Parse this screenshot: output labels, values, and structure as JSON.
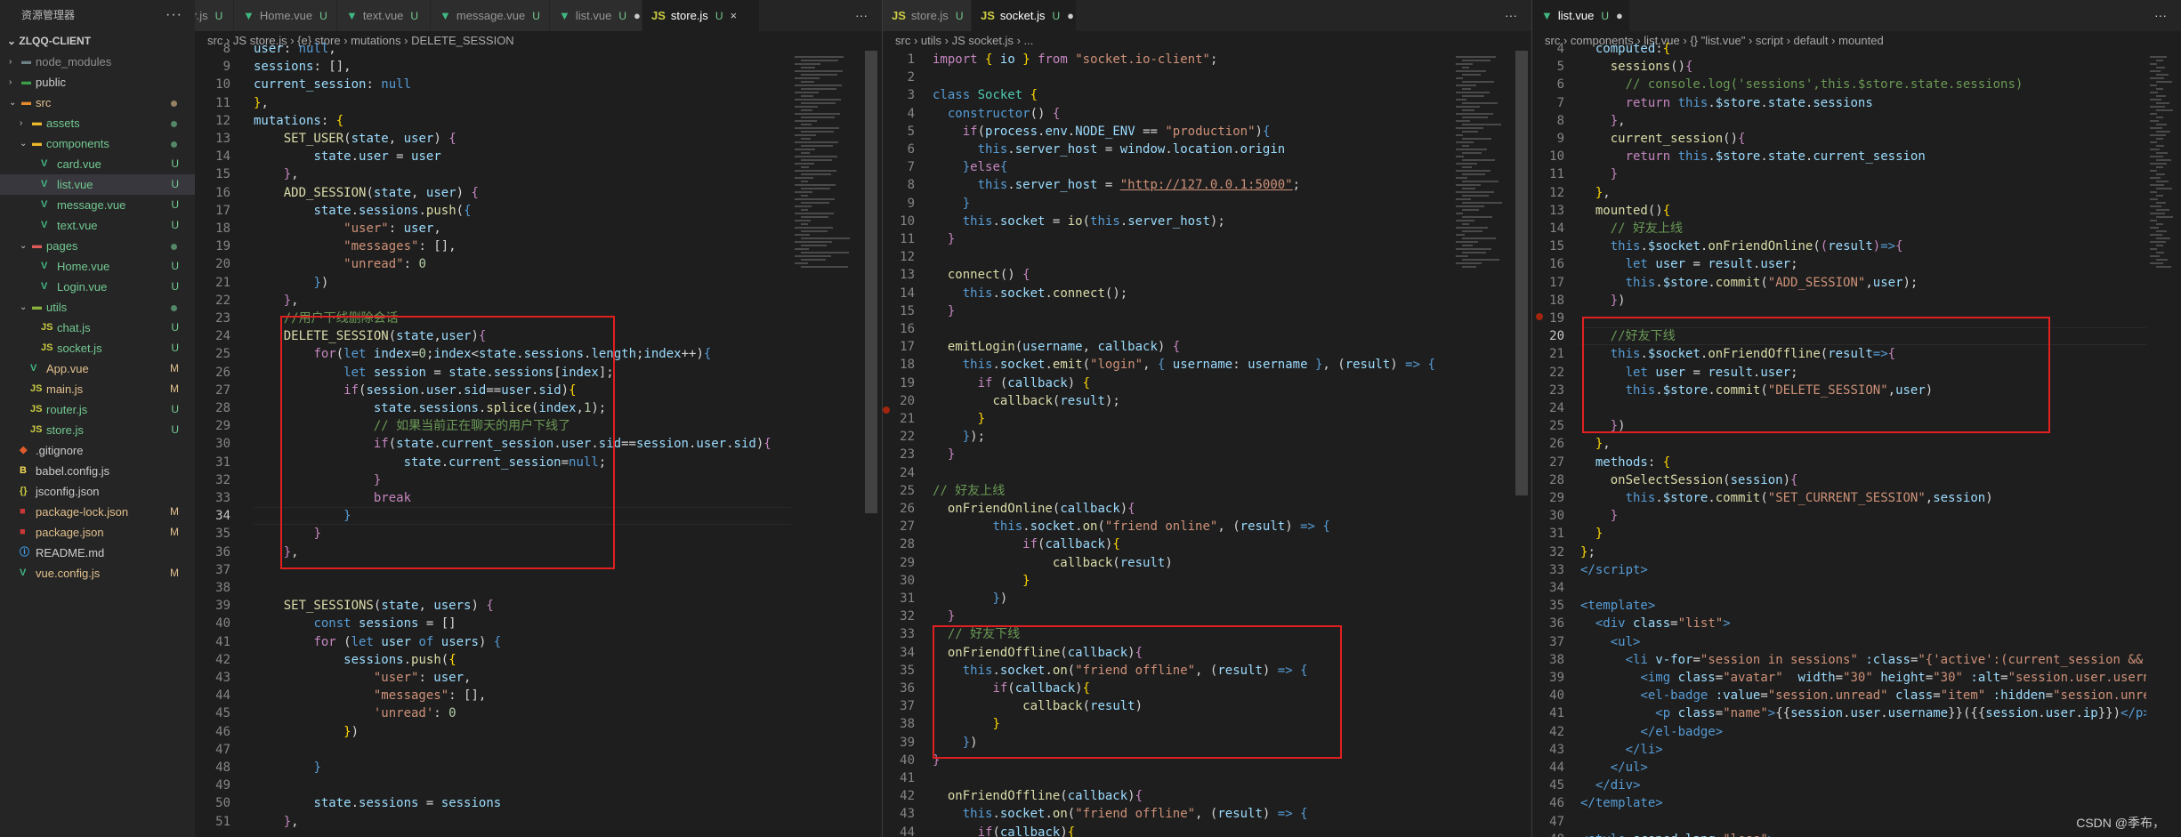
{
  "explorer": {
    "title": "资源管理器",
    "more": "···",
    "project": "ZLQQ-CLIENT"
  },
  "tree": [
    {
      "name": "node_modules",
      "kind": "folder",
      "depth": 1,
      "open": false,
      "icon": "#6d8086",
      "color": "#8f8f8f"
    },
    {
      "name": "public",
      "kind": "folder",
      "depth": 1,
      "open": false,
      "icon": "#3c9e48",
      "color": "#cccccc"
    },
    {
      "name": "src",
      "kind": "folder",
      "depth": 1,
      "open": true,
      "icon": "#e8892b",
      "color": "#e2c08d",
      "dot": true
    },
    {
      "name": "assets",
      "kind": "folder",
      "depth": 2,
      "open": false,
      "icon": "#e8b92b",
      "color": "#73c991",
      "dot": true
    },
    {
      "name": "components",
      "kind": "folder",
      "depth": 2,
      "open": true,
      "icon": "#e8b92b",
      "color": "#73c991",
      "dot": true
    },
    {
      "name": "card.vue",
      "kind": "vue",
      "depth": 3,
      "color": "#73c991",
      "badge": "U"
    },
    {
      "name": "list.vue",
      "kind": "vue",
      "depth": 3,
      "color": "#73c991",
      "badge": "U",
      "selected": true
    },
    {
      "name": "message.vue",
      "kind": "vue",
      "depth": 3,
      "color": "#73c991",
      "badge": "U"
    },
    {
      "name": "text.vue",
      "kind": "vue",
      "depth": 3,
      "color": "#73c991",
      "badge": "U"
    },
    {
      "name": "pages",
      "kind": "folder",
      "depth": 2,
      "open": true,
      "icon": "#e05a5a",
      "color": "#73c991",
      "dot": true
    },
    {
      "name": "Home.vue",
      "kind": "vue",
      "depth": 3,
      "color": "#73c991",
      "badge": "U"
    },
    {
      "name": "Login.vue",
      "kind": "vue",
      "depth": 3,
      "color": "#73c991",
      "badge": "U"
    },
    {
      "name": "utils",
      "kind": "folder",
      "depth": 2,
      "open": true,
      "icon": "#8ab23a",
      "color": "#73c991",
      "dot": true
    },
    {
      "name": "chat.js",
      "kind": "js",
      "depth": 3,
      "color": "#73c991",
      "badge": "U"
    },
    {
      "name": "socket.js",
      "kind": "js",
      "depth": 3,
      "color": "#73c991",
      "badge": "U"
    },
    {
      "name": "App.vue",
      "kind": "vue",
      "depth": 2,
      "color": "#e2c08d",
      "badge": "M"
    },
    {
      "name": "main.js",
      "kind": "js",
      "depth": 2,
      "color": "#e2c08d",
      "badge": "M"
    },
    {
      "name": "router.js",
      "kind": "js",
      "depth": 2,
      "color": "#73c991",
      "badge": "U"
    },
    {
      "name": "store.js",
      "kind": "js",
      "depth": 2,
      "color": "#73c991",
      "badge": "U"
    },
    {
      "name": ".gitignore",
      "kind": "git",
      "depth": 1,
      "color": "#cccccc"
    },
    {
      "name": "babel.config.js",
      "kind": "babel",
      "depth": 1,
      "color": "#cccccc"
    },
    {
      "name": "jsconfig.json",
      "kind": "json",
      "depth": 1,
      "color": "#cccccc"
    },
    {
      "name": "package-lock.json",
      "kind": "npm",
      "depth": 1,
      "color": "#e2c08d",
      "badge": "M"
    },
    {
      "name": "package.json",
      "kind": "npm",
      "depth": 1,
      "color": "#e2c08d",
      "badge": "M"
    },
    {
      "name": "README.md",
      "kind": "info",
      "depth": 1,
      "color": "#cccccc"
    },
    {
      "name": "vue.config.js",
      "kind": "vuecfg",
      "depth": 1,
      "color": "#e2c08d",
      "badge": "M"
    }
  ],
  "panes": [
    {
      "id": "left",
      "tabs": [
        {
          "label": "r.js",
          "icon": "",
          "mark": "U"
        },
        {
          "label": "Home.vue",
          "icon": "vue",
          "mark": "U"
        },
        {
          "label": "text.vue",
          "icon": "vue",
          "mark": "U"
        },
        {
          "label": "message.vue",
          "icon": "vue",
          "mark": "U"
        },
        {
          "label": "list.vue",
          "icon": "vue",
          "mark": "U",
          "dirty": true
        },
        {
          "label": "store.js",
          "icon": "JS",
          "mark": "U",
          "active": true,
          "close": "×"
        }
      ],
      "crumbs": [
        "src",
        "JS store.js",
        "{e} store",
        "mutations",
        "DELETE_SESSION"
      ],
      "start": 8,
      "lines": [
        "<span class='v'>user</span>: <span class='kb'>null</span>,",
        "<span class='v'>sessions</span>: [],",
        "<span class='v'>current_session</span>: <span class='kb'>null</span>",
        "<span class='p'>}</span>,",
        "<span class='v'>mutations</span>: <span class='p'>{</span>",
        "    <span class='f'>SET_USER</span>(<span class='v'>state</span>, <span class='v'>user</span>) <span class='k'>{</span>",
        "        <span class='v'>state</span>.<span class='v'>user</span> = <span class='v'>user</span>",
        "    <span class='k'>}</span>,",
        "    <span class='f'>ADD_SESSION</span>(<span class='v'>state</span>, <span class='v'>user</span>) <span class='k'>{</span>",
        "        <span class='v'>state</span>.<span class='v'>sessions</span>.<span class='f'>push</span>(<span class='kb'>{</span>",
        "            <span class='s'>\"user\"</span>: <span class='v'>user</span>,",
        "            <span class='s'>\"messages\"</span>: [],",
        "            <span class='s'>\"unread\"</span>: <span class='n'>0</span>",
        "        <span class='kb'>}</span>)",
        "    <span class='k'>}</span>,",
        "    <span class='c'>//用户下线删除会话</span>",
        "    <span class='f'>DELETE_SESSION</span>(<span class='v'>state</span>,<span class='v'>user</span>)<span class='k'>{</span>",
        "        <span class='k'>for</span>(<span class='kb'>let</span> <span class='v'>index</span>=<span class='n'>0</span>;<span class='v'>index</span>&lt;<span class='v'>state</span>.<span class='v'>sessions</span>.<span class='v'>length</span>;<span class='v'>index</span>++)<span class='kb'>{</span>",
        "            <span class='kb'>let</span> <span class='v'>session</span> = <span class='v'>state</span>.<span class='v'>sessions</span>[<span class='v'>index</span>];",
        "            <span class='k'>if</span>(<span class='v'>session</span>.<span class='v'>user</span>.<span class='v'>sid</span>==<span class='v'>user</span>.<span class='v'>sid</span>)<span class='p'>{</span>",
        "                <span class='v'>state</span>.<span class='v'>sessions</span>.<span class='f'>splice</span>(<span class='v'>index</span>,<span class='n'>1</span>);",
        "                <span class='c'>// 如果当前正在聊天的用户下线了</span>",
        "                <span class='k'>if</span>(<span class='v'>state</span>.<span class='v'>current_session</span>.<span class='v'>user</span>.<span class='v'>sid</span>==<span class='v'>session</span>.<span class='v'>user</span>.<span class='v'>sid</span>)<span class='k'>{</span>",
        "                    <span class='v'>state</span>.<span class='v'>current_session</span>=<span class='kb'>null</span>;",
        "                <span class='k'>}</span>",
        "                <span class='k'>break</span>",
        "            <span class='kb'>}</span>",
        "        <span class='k'>}</span>",
        "    <span class='k'>}</span>,",
        "",
        "",
        "    <span class='f'>SET_SESSIONS</span>(<span class='v'>state</span>, <span class='v'>users</span>) <span class='k'>{</span>",
        "        <span class='kb'>const</span> <span class='v'>sessions</span> = []",
        "        <span class='k'>for</span> (<span class='kb'>let</span> <span class='v'>user</span> <span class='kb'>of</span> <span class='v'>users</span>) <span class='kb'>{</span>",
        "            <span class='v'>sessions</span>.<span class='f'>push</span>(<span class='p'>{</span>",
        "                <span class='s'>\"user\"</span>: <span class='v'>user</span>,",
        "                <span class='s'>\"messages\"</span>: [],",
        "                <span class='s'>'unread'</span>: <span class='n'>0</span>",
        "            <span class='p'>}</span>)",
        "",
        "        <span class='kb'>}</span>",
        "",
        "        <span class='v'>state</span>.<span class='v'>sessions</span> = <span class='v'>sessions</span>",
        "    <span class='k'>}</span>,"
      ],
      "curline": 34
    },
    {
      "id": "mid",
      "tabs": [
        {
          "label": "store.js",
          "icon": "JS",
          "mark": "U"
        },
        {
          "label": "socket.js",
          "icon": "JS",
          "mark": "U",
          "active": true,
          "dirty": true
        }
      ],
      "crumbs": [
        "src",
        "utils",
        "JS socket.js",
        "..."
      ],
      "start": 1,
      "lines": [
        "<span class='k'>import</span> <span class='p'>{</span> <span class='v'>io</span> <span class='p'>}</span> <span class='k'>from</span> <span class='s'>\"socket.io-client\"</span>;",
        "",
        "<span class='kb'>class</span> <span class='t'>Socket</span> <span class='p'>{</span>",
        "  <span class='kb'>constructor</span>() <span class='k'>{</span>",
        "    <span class='k'>if</span>(<span class='v'>process</span>.<span class='v'>env</span>.<span class='v'>NODE_ENV</span> == <span class='s'>\"production\"</span>)<span class='kb'>{</span>",
        "      <span class='kb'>this</span>.<span class='v'>server_host</span> = <span class='v'>window</span>.<span class='v'>location</span>.<span class='v'>origin</span>",
        "    <span class='kb'>}</span><span class='k'>else</span><span class='kb'>{</span>",
        "      <span class='kb'>this</span>.<span class='v'>server_host</span> = <span class='u'>\"http://127.0.0.1:5000\"</span>;",
        "    <span class='kb'>}</span>",
        "    <span class='kb'>this</span>.<span class='v'>socket</span> = <span class='f'>io</span>(<span class='kb'>this</span>.<span class='v'>server_host</span>);",
        "  <span class='k'>}</span>",
        "",
        "  <span class='f'>connect</span>() <span class='k'>{</span>",
        "    <span class='kb'>this</span>.<span class='v'>socket</span>.<span class='f'>connect</span>();",
        "  <span class='k'>}</span>",
        "",
        "  <span class='f'>emitLogin</span>(<span class='v'>username</span>, <span class='v'>callback</span>) <span class='k'>{</span>",
        "    <span class='kb'>this</span>.<span class='v'>socket</span>.<span class='f'>emit</span>(<span class='s'>\"login\"</span>, <span class='kb'>{</span> <span class='v'>username</span>: <span class='v'>username</span> <span class='kb'>}</span>, (<span class='v'>result</span>) <span class='kb'>=&gt;</span> <span class='kb'>{</span>",
        "      <span class='k'>if</span> (<span class='v'>callback</span>) <span class='p'>{</span>",
        "        <span class='f'>callback</span>(<span class='v'>result</span>);",
        "      <span class='p'>}</span>",
        "    <span class='kb'>}</span>);",
        "  <span class='k'>}</span>",
        "",
        "<span class='c'>// 好友上线</span>",
        "  <span class='f'>onFriendOnline</span>(<span class='v'>callback</span>)<span class='k'>{</span>",
        "        <span class='kb'>this</span>.<span class='v'>socket</span>.<span class='f'>on</span>(<span class='s'>\"friend online\"</span>, (<span class='v'>result</span>) <span class='kb'>=&gt;</span> <span class='kb'>{</span>",
        "            <span class='k'>if</span>(<span class='v'>callback</span>)<span class='p'>{</span>",
        "                <span class='f'>callback</span>(<span class='v'>result</span>)",
        "            <span class='p'>}</span>",
        "        <span class='kb'>}</span>)",
        "  <span class='k'>}</span>",
        "  <span class='c'>// 好友下线</span>",
        "  <span class='f'>onFriendOffline</span>(<span class='v'>callback</span>)<span class='k'>{</span>",
        "    <span class='kb'>this</span>.<span class='v'>socket</span>.<span class='f'>on</span>(<span class='s'>\"friend offline\"</span>, (<span class='v'>result</span>) <span class='kb'>=&gt;</span> <span class='kb'>{</span>",
        "        <span class='k'>if</span>(<span class='v'>callback</span>)<span class='p'>{</span>",
        "            <span class='f'>callback</span>(<span class='v'>result</span>)",
        "        <span class='p'>}</span>",
        "    <span class='kb'>}</span>)",
        "<span class='k'>}</span>",
        "",
        "  <span class='f'>onFriendOffline</span>(<span class='v'>callback</span>)<span class='k'>{</span>",
        "    <span class='kb'>this</span>.<span class='v'>socket</span>.<span class='f'>on</span>(<span class='s'>\"friend offline\"</span>, (<span class='v'>result</span>) <span class='kb'>=&gt;</span> <span class='kb'>{</span>",
        "      <span class='k'>if</span>(<span class='v'>callback</span>)<span class='p'>{</span>",
        "        <span class='f'>callback</span>(<span class='v'>result</span>)"
      ],
      "curline": 0
    },
    {
      "id": "right",
      "tabs": [
        {
          "label": "list.vue",
          "icon": "vue",
          "mark": "U",
          "active": true,
          "dirty": true
        }
      ],
      "crumbs": [
        "src",
        "components",
        "list.vue",
        "{} \"list.vue\"",
        "script",
        "default",
        "mounted"
      ],
      "start": 4,
      "lines": [
        "  <span class='v'>computed</span>:<span class='p'>{</span>",
        "    <span class='f'>sessions</span>()<span class='k'>{</span>",
        "      <span class='c'>// console.log('sessions',this.$store.state.sessions)</span>",
        "      <span class='k'>return</span> <span class='kb'>this</span>.<span class='v'>$store</span>.<span class='v'>state</span>.<span class='v'>sessions</span>",
        "    <span class='k'>}</span>,",
        "    <span class='f'>current_session</span>()<span class='k'>{</span>",
        "      <span class='k'>return</span> <span class='kb'>this</span>.<span class='v'>$store</span>.<span class='v'>state</span>.<span class='v'>current_session</span>",
        "    <span class='k'>}</span>",
        "  <span class='p'>}</span>,",
        "  <span class='f'>mounted</span>()<span class='p'>{</span>",
        "    <span class='c'>// 好友上线</span>",
        "    <span class='kb'>this</span>.<span class='v'>$socket</span>.<span class='f'>onFriendOnline</span>(<span class='k'>(</span><span class='v'>result</span><span class='k'>)</span><span class='kb'>=&gt;</span><span class='k'>{</span>",
        "      <span class='kb'>let</span> <span class='v'>user</span> = <span class='v'>result</span>.<span class='v'>user</span>;",
        "      <span class='kb'>this</span>.<span class='v'>$store</span>.<span class='f'>commit</span>(<span class='s'>\"ADD_SESSION\"</span>,<span class='v'>user</span>);",
        "    <span class='k'>}</span>)",
        "",
        "    <span class='c'>//好友下线</span>",
        "    <span class='kb'>this</span>.<span class='v'>$socket</span>.<span class='f'>onFriendOffline</span>(<span class='v'>result</span><span class='kb'>=&gt;</span><span class='k'>{</span>",
        "      <span class='kb'>let</span> <span class='v'>user</span> = <span class='v'>result</span>.<span class='v'>user</span>;",
        "      <span class='kb'>this</span>.<span class='v'>$store</span>.<span class='f'>commit</span>(<span class='s'>\"DELETE_SESSION\"</span>,<span class='v'>user</span>)",
        "",
        "    <span class='k'>}</span>)",
        "  <span class='p'>}</span>,",
        "  <span class='v'>methods</span>: <span class='p'>{</span>",
        "    <span class='f'>onSelectSession</span>(<span class='v'>session</span>)<span class='k'>{</span>",
        "      <span class='kb'>this</span>.<span class='v'>$store</span>.<span class='f'>commit</span>(<span class='s'>\"SET_CURRENT_SESSION\"</span>,<span class='v'>session</span>)",
        "    <span class='k'>}</span>",
        "  <span class='p'>}</span>",
        "<span class='p'>}</span>;",
        "<span class='tg'>&lt;/script&gt;</span>",
        "",
        "<span class='tg'>&lt;template&gt;</span>",
        "  <span class='tg'>&lt;div</span> <span class='at'>class</span>=<span class='s'>\"list\"</span><span class='tg'>&gt;</span>",
        "    <span class='tg'>&lt;ul&gt;</span>",
        "      <span class='tg'>&lt;li</span> <span class='at'>v-for</span>=<span class='s'>\"session in sessions\"</span> <span class='at'>:class</span>=<span class='s'>\"{'active':(current_session &amp;&amp; se</span>",
        "        <span class='tg'>&lt;img</span> <span class='at'>class</span>=<span class='s'>\"avatar\"</span>  <span class='at'>width</span>=<span class='s'>\"30\"</span> <span class='at'>height</span>=<span class='s'>\"30\"</span> <span class='at'>:alt</span>=<span class='s'>\"session.user.usernam</span>",
        "        <span class='tg'>&lt;el-badge</span> <span class='at'>:value</span>=<span class='s'>\"session.unread\"</span> <span class='at'>class</span>=<span class='s'>\"item\"</span> <span class='at'>:hidden</span>=<span class='s'>\"session.unread</span>",
        "          <span class='tg'>&lt;p</span> <span class='at'>class</span>=<span class='s'>\"name\"</span><span class='tg'>&gt;</span>{{<span class='v'>session</span>.<span class='v'>user</span>.<span class='v'>username</span>}}({{<span class='v'>session</span>.<span class='v'>user</span>.<span class='v'>ip</span>}})<span class='tg'>&lt;/p&gt;</span>",
        "        <span class='tg'>&lt;/el-badge&gt;</span>",
        "      <span class='tg'>&lt;/li&gt;</span>",
        "    <span class='tg'>&lt;/ul&gt;</span>",
        "  <span class='tg'>&lt;/div&gt;</span>",
        "<span class='tg'>&lt;/template&gt;</span>",
        "",
        "<span class='tg'>&lt;style</span> <span class='at'>scoped</span> <span class='at'>lang</span>=<span class='s'>\"less\"</span><span class='tg'>&gt;</span>"
      ],
      "curline": 20
    }
  ],
  "watermark": "CSDN @季布，",
  "colors": {
    "accent": "#e02020",
    "modified": "#e2c08d",
    "untracked": "#73c991"
  }
}
